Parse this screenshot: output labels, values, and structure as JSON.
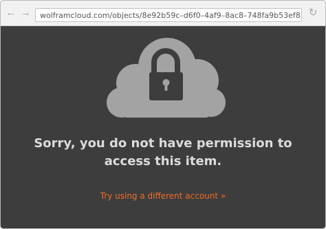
{
  "browser": {
    "back_icon": "back-arrow-icon",
    "back_glyph": "←",
    "forward_icon": "forward-arrow-icon",
    "forward_glyph": "→",
    "url": "wolframcloud.com/objects/8e92b59c–d6f0–4af9–8ac8–748fa9b53ef8",
    "reload_icon": "reload-icon",
    "reload_glyph": "↻"
  },
  "page": {
    "illustration_icon": "cloud-lock-icon",
    "message": "Sorry, you do not have permission to access this item.",
    "link_label": "Try using a different account »"
  },
  "colors": {
    "background": "#3d3d3d",
    "cloud": "#a3a3a3",
    "lock": "#3d3d3d",
    "message": "#dcdcdc",
    "link": "#f26b26",
    "toolbar": "#f1f1f1"
  }
}
